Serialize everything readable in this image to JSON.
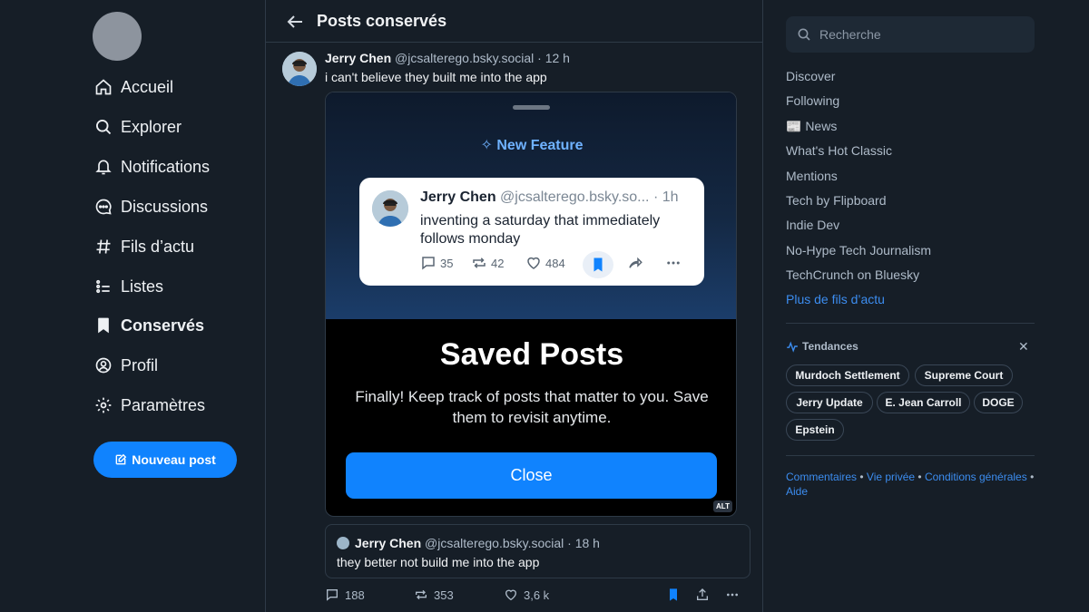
{
  "nav": {
    "items": [
      {
        "label": "Accueil",
        "icon": "home-icon"
      },
      {
        "label": "Explorer",
        "icon": "search-icon"
      },
      {
        "label": "Notifications",
        "icon": "bell-icon"
      },
      {
        "label": "Discussions",
        "icon": "chat-icon"
      },
      {
        "label": "Fils d’actu",
        "icon": "hash-icon"
      },
      {
        "label": "Listes",
        "icon": "list-icon"
      },
      {
        "label": "Conservés",
        "icon": "bookmark-icon",
        "active": true
      },
      {
        "label": "Profil",
        "icon": "profile-icon"
      },
      {
        "label": "Paramètres",
        "icon": "gear-icon"
      }
    ],
    "new_post": "Nouveau post"
  },
  "header": {
    "title": "Posts conservés"
  },
  "post": {
    "author": "Jerry Chen",
    "handle": "@jcsalterego.bsky.social",
    "time": "· 12 h",
    "text": "i can't believe they built me into the app",
    "media": {
      "new_feature": "New Feature",
      "card": {
        "author": "Jerry Chen",
        "handle": "@jcsalterego.bsky.so...",
        "time": "· 1h",
        "text": "inventing a saturday that immediately follows monday",
        "replies": "35",
        "reposts": "42",
        "likes": "484"
      },
      "title": "Saved Posts",
      "description": "Finally! Keep track of posts that matter to you. Save them to revisit anytime.",
      "close": "Close",
      "alt": "ALT"
    },
    "quote": {
      "author": "Jerry Chen",
      "handle": "@jcsalterego.bsky.social",
      "time": "· 18 h",
      "text": "they better not build me into the app"
    },
    "stats": {
      "replies": "188",
      "reposts": "353",
      "likes": "3,6 k"
    }
  },
  "sidebar": {
    "search_placeholder": "Recherche",
    "feeds": [
      "Discover",
      "Following",
      "📰 News",
      "What's Hot Classic",
      "Mentions",
      "Tech by Flipboard",
      "Indie Dev",
      "No-Hype Tech Journalism",
      "TechCrunch on Bluesky"
    ],
    "more_feeds": "Plus de fils d’actu",
    "trends_title": "Tendances",
    "trends": [
      "Murdoch Settlement",
      "Supreme Court",
      "Jerry Update",
      "E. Jean Carroll",
      "DOGE",
      "Epstein"
    ],
    "footer": {
      "feedback": "Commentaires",
      "privacy": "Vie privée",
      "terms": "Conditions générales",
      "help": "Aide",
      "dot": "•"
    }
  },
  "colors": {
    "accent": "#1083fe",
    "background": "#161e27",
    "link": "#3c8df0"
  }
}
